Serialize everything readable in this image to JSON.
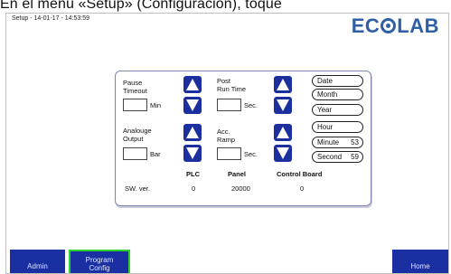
{
  "caption": "En el menú «Setup» (Configuración), toque",
  "header": {
    "title": "Setup - 14-01-17 - 14:53:59"
  },
  "brand": {
    "left": "EC",
    "right": "LAB",
    "color": "#2f5fa5"
  },
  "settings": {
    "pause_timeout": {
      "label_line1": "Pause",
      "label_line2": "Timeout",
      "unit": "Min",
      "value": ""
    },
    "post_run_time": {
      "label_line1": "Post",
      "label_line2": "Run Time",
      "unit": "Sec.",
      "value": ""
    },
    "analogue_output": {
      "label_line1": "Analouge",
      "label_line2": "Output",
      "unit": "Bar",
      "value": ""
    },
    "acc_ramp": {
      "label_line1": "Acc.",
      "label_line2": "Ramp",
      "unit": "Sec.",
      "value": ""
    }
  },
  "datetime": {
    "date": {
      "label": "Date",
      "value": ""
    },
    "month": {
      "label": "Month",
      "value": ""
    },
    "year": {
      "label": "Year",
      "value": ""
    },
    "hour": {
      "label": "Hour",
      "value": ""
    },
    "minute": {
      "label": "Minute",
      "value": "53"
    },
    "second": {
      "label": "Second",
      "value": "59"
    }
  },
  "versions": {
    "row_label": "SW. ver.",
    "plc": {
      "header": "PLC",
      "value": "0"
    },
    "panel": {
      "header": "Panel",
      "value": "20000"
    },
    "control_board": {
      "header": "Control Board",
      "value": "0"
    }
  },
  "nav": {
    "admin": "Admin",
    "program_line1": "Program",
    "program_line2": "Config",
    "home": "Home"
  },
  "colors": {
    "button": "#1a2fa1",
    "active_border": "#2ed12e"
  },
  "icons": {
    "up": "arrow-up-icon",
    "down": "arrow-down-icon"
  }
}
